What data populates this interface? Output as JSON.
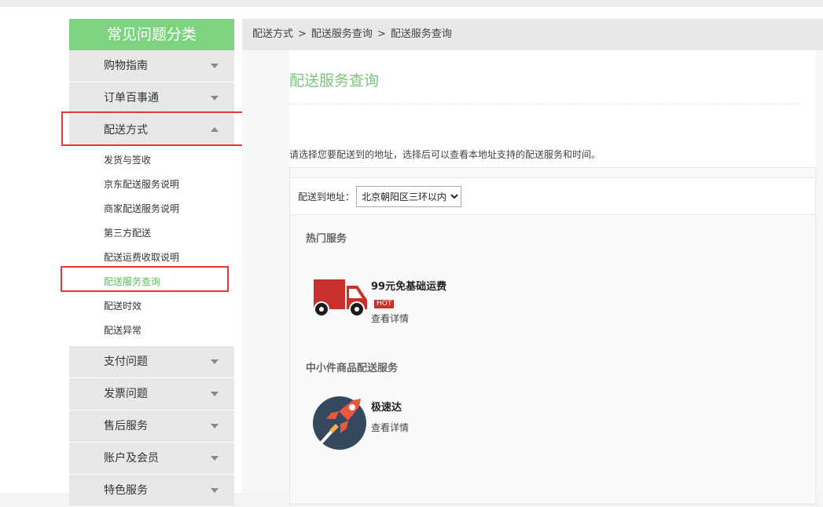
{
  "sidebar": {
    "title": "常见问题分类",
    "categories_top": [
      "购物指南",
      "订单百事通"
    ],
    "expanded": {
      "label": "配送方式",
      "subs": [
        "发货与签收",
        "京东配送服务说明",
        "商家配送服务说明",
        "第三方配送",
        "配送运费收取说明",
        "配送服务查询",
        "配送时效",
        "配送异常"
      ],
      "active_index": 5
    },
    "categories_bottom": [
      "支付问题",
      "发票问题",
      "售后服务",
      "账户及会员",
      "特色服务"
    ]
  },
  "breadcrumb": [
    "配送方式",
    "配送服务查询",
    "配送服务查询"
  ],
  "main": {
    "title": "配送服务查询",
    "intro": "请选择您要配送到的地址，选择后可以查看本地址支持的配送服务和时间。",
    "address_label": "配送到地址：",
    "address_selected": "北京朝阳区三环以内",
    "sections": [
      {
        "title": "热门服务",
        "services": [
          {
            "name": "99元免基础运费",
            "badge": "HOT",
            "link": "查看详情",
            "icon": "truck-icon"
          }
        ]
      },
      {
        "title": "中小件商品配送服务",
        "services": [
          {
            "name": "极速达",
            "link": "查看详情",
            "icon": "rocket-icon"
          }
        ]
      }
    ]
  },
  "colors": {
    "accent": "#7dd47f",
    "highlight": "#e53935",
    "truck": "#c9302c",
    "rocket_bg": "#34485e"
  }
}
